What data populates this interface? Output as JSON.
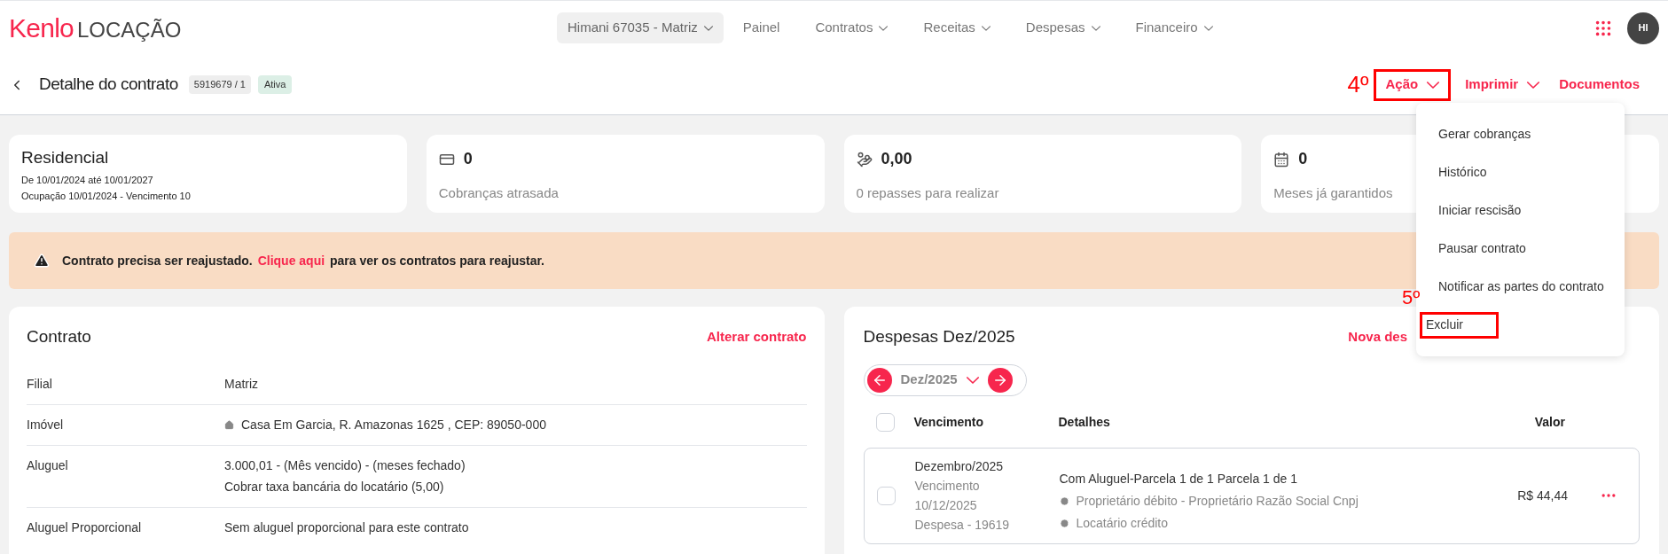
{
  "header": {
    "logo_brand": "Kenlo",
    "logo_product": "LOCAÇÃO",
    "branch_selector": "Himani 67035 - Matriz",
    "avatar": "HI",
    "nav": [
      {
        "label": "Painel",
        "has_menu": false
      },
      {
        "label": "Contratos",
        "has_menu": true
      },
      {
        "label": "Receitas",
        "has_menu": true
      },
      {
        "label": "Despesas",
        "has_menu": true
      },
      {
        "label": "Financeiro",
        "has_menu": true
      }
    ]
  },
  "page": {
    "title": "Detalhe do contrato",
    "contract_number": "5919679 / 1",
    "status": "Ativa",
    "actions": [
      {
        "label": "Ação",
        "has_menu": true,
        "highlighted": true,
        "annotation": "4º"
      },
      {
        "label": "Imprimir",
        "has_menu": true,
        "highlighted": false
      },
      {
        "label": "Documentos",
        "has_menu": false,
        "highlighted": false
      }
    ]
  },
  "summary_cards": [
    {
      "kind": "info",
      "title": "Residencial",
      "lines": [
        "De 10/01/2024 até 10/01/2027",
        "Ocupação 10/01/2024 - Vencimento 10"
      ]
    },
    {
      "kind": "stat",
      "value": "0",
      "label": "Cobranças atrasada"
    },
    {
      "kind": "stat",
      "value": "0,00",
      "label": "0 repasses para realizar"
    },
    {
      "kind": "stat",
      "value": "0",
      "label": "Meses já garantidos"
    }
  ],
  "alert": {
    "text": "Contrato precisa ser reajustado.",
    "link": "Clique aqui",
    "text_after": "para ver os contratos para reajustar."
  },
  "contract": {
    "title": "Contrato",
    "edit_link": "Alterar contrato",
    "rows": [
      {
        "label": "Filial",
        "values": [
          "Matriz"
        ],
        "kind": "plain"
      },
      {
        "label": "Imóvel",
        "values": [
          "Casa Em Garcia, R. Amazonas 1625 , CEP: 89050-000"
        ],
        "kind": "property"
      },
      {
        "label": "Aluguel",
        "values": [
          "3.000,01 - (Mês vencido) - (meses fechado)",
          "Cobrar taxa bancária do locatário (5,00)"
        ],
        "kind": "plain"
      },
      {
        "label": "Aluguel Proporcional",
        "values": [
          "Sem aluguel proporcional para este contrato"
        ],
        "kind": "plain"
      }
    ]
  },
  "expenses": {
    "title": "Despesas Dez/2025",
    "new_link": "Nova des",
    "month": "Dez/2025",
    "columns": [
      "Vencimento",
      "Detalhes",
      "Valor"
    ],
    "select_all_checked": false,
    "rows": [
      {
        "checked": false,
        "month": "Dezembro/2025",
        "due_lines": [
          "Vencimento",
          "10/12/2025",
          "Despesa - 19619"
        ],
        "title": "Com Aluguel-Parcela 1 de 1 Parcela 1 de 1",
        "details": [
          "Proprietário débito - Proprietário Razão Social Cnpj",
          "Locatário crédito"
        ],
        "value": "R$ 44,44"
      }
    ]
  },
  "action_menu": {
    "open": true,
    "items": [
      {
        "label": "Gerar cobranças",
        "highlighted": false
      },
      {
        "label": "Histórico",
        "highlighted": false
      },
      {
        "label": "Iniciar rescisão",
        "highlighted": false
      },
      {
        "label": "Pausar contrato",
        "highlighted": false
      },
      {
        "label": "Notificar as partes do contrato",
        "highlighted": false
      },
      {
        "label": "Excluir",
        "highlighted": true,
        "annotation": "5º"
      }
    ]
  }
}
